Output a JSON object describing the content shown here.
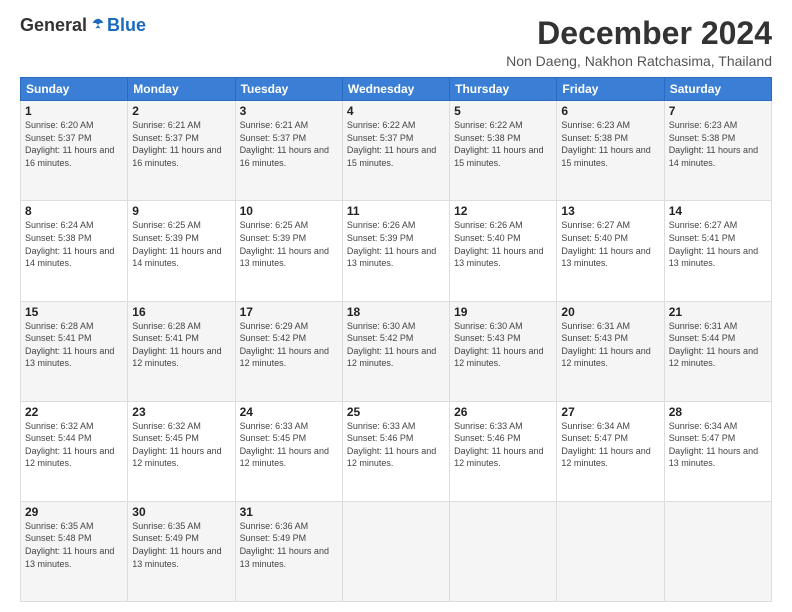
{
  "header": {
    "logo_general": "General",
    "logo_blue": "Blue",
    "month_title": "December 2024",
    "location": "Non Daeng, Nakhon Ratchasima, Thailand"
  },
  "days_of_week": [
    "Sunday",
    "Monday",
    "Tuesday",
    "Wednesday",
    "Thursday",
    "Friday",
    "Saturday"
  ],
  "weeks": [
    [
      {
        "day": "1",
        "sunrise": "6:20 AM",
        "sunset": "5:37 PM",
        "daylight": "11 hours and 16 minutes."
      },
      {
        "day": "2",
        "sunrise": "6:21 AM",
        "sunset": "5:37 PM",
        "daylight": "11 hours and 16 minutes."
      },
      {
        "day": "3",
        "sunrise": "6:21 AM",
        "sunset": "5:37 PM",
        "daylight": "11 hours and 16 minutes."
      },
      {
        "day": "4",
        "sunrise": "6:22 AM",
        "sunset": "5:37 PM",
        "daylight": "11 hours and 15 minutes."
      },
      {
        "day": "5",
        "sunrise": "6:22 AM",
        "sunset": "5:38 PM",
        "daylight": "11 hours and 15 minutes."
      },
      {
        "day": "6",
        "sunrise": "6:23 AM",
        "sunset": "5:38 PM",
        "daylight": "11 hours and 15 minutes."
      },
      {
        "day": "7",
        "sunrise": "6:23 AM",
        "sunset": "5:38 PM",
        "daylight": "11 hours and 14 minutes."
      }
    ],
    [
      {
        "day": "8",
        "sunrise": "6:24 AM",
        "sunset": "5:38 PM",
        "daylight": "11 hours and 14 minutes."
      },
      {
        "day": "9",
        "sunrise": "6:25 AM",
        "sunset": "5:39 PM",
        "daylight": "11 hours and 14 minutes."
      },
      {
        "day": "10",
        "sunrise": "6:25 AM",
        "sunset": "5:39 PM",
        "daylight": "11 hours and 13 minutes."
      },
      {
        "day": "11",
        "sunrise": "6:26 AM",
        "sunset": "5:39 PM",
        "daylight": "11 hours and 13 minutes."
      },
      {
        "day": "12",
        "sunrise": "6:26 AM",
        "sunset": "5:40 PM",
        "daylight": "11 hours and 13 minutes."
      },
      {
        "day": "13",
        "sunrise": "6:27 AM",
        "sunset": "5:40 PM",
        "daylight": "11 hours and 13 minutes."
      },
      {
        "day": "14",
        "sunrise": "6:27 AM",
        "sunset": "5:41 PM",
        "daylight": "11 hours and 13 minutes."
      }
    ],
    [
      {
        "day": "15",
        "sunrise": "6:28 AM",
        "sunset": "5:41 PM",
        "daylight": "11 hours and 13 minutes."
      },
      {
        "day": "16",
        "sunrise": "6:28 AM",
        "sunset": "5:41 PM",
        "daylight": "11 hours and 12 minutes."
      },
      {
        "day": "17",
        "sunrise": "6:29 AM",
        "sunset": "5:42 PM",
        "daylight": "11 hours and 12 minutes."
      },
      {
        "day": "18",
        "sunrise": "6:30 AM",
        "sunset": "5:42 PM",
        "daylight": "11 hours and 12 minutes."
      },
      {
        "day": "19",
        "sunrise": "6:30 AM",
        "sunset": "5:43 PM",
        "daylight": "11 hours and 12 minutes."
      },
      {
        "day": "20",
        "sunrise": "6:31 AM",
        "sunset": "5:43 PM",
        "daylight": "11 hours and 12 minutes."
      },
      {
        "day": "21",
        "sunrise": "6:31 AM",
        "sunset": "5:44 PM",
        "daylight": "11 hours and 12 minutes."
      }
    ],
    [
      {
        "day": "22",
        "sunrise": "6:32 AM",
        "sunset": "5:44 PM",
        "daylight": "11 hours and 12 minutes."
      },
      {
        "day": "23",
        "sunrise": "6:32 AM",
        "sunset": "5:45 PM",
        "daylight": "11 hours and 12 minutes."
      },
      {
        "day": "24",
        "sunrise": "6:33 AM",
        "sunset": "5:45 PM",
        "daylight": "11 hours and 12 minutes."
      },
      {
        "day": "25",
        "sunrise": "6:33 AM",
        "sunset": "5:46 PM",
        "daylight": "11 hours and 12 minutes."
      },
      {
        "day": "26",
        "sunrise": "6:33 AM",
        "sunset": "5:46 PM",
        "daylight": "11 hours and 12 minutes."
      },
      {
        "day": "27",
        "sunrise": "6:34 AM",
        "sunset": "5:47 PM",
        "daylight": "11 hours and 12 minutes."
      },
      {
        "day": "28",
        "sunrise": "6:34 AM",
        "sunset": "5:47 PM",
        "daylight": "11 hours and 13 minutes."
      }
    ],
    [
      {
        "day": "29",
        "sunrise": "6:35 AM",
        "sunset": "5:48 PM",
        "daylight": "11 hours and 13 minutes."
      },
      {
        "day": "30",
        "sunrise": "6:35 AM",
        "sunset": "5:49 PM",
        "daylight": "11 hours and 13 minutes."
      },
      {
        "day": "31",
        "sunrise": "6:36 AM",
        "sunset": "5:49 PM",
        "daylight": "11 hours and 13 minutes."
      },
      null,
      null,
      null,
      null
    ]
  ],
  "labels": {
    "sunrise_prefix": "Sunrise: ",
    "sunset_prefix": "Sunset: ",
    "daylight_prefix": "Daylight: "
  }
}
